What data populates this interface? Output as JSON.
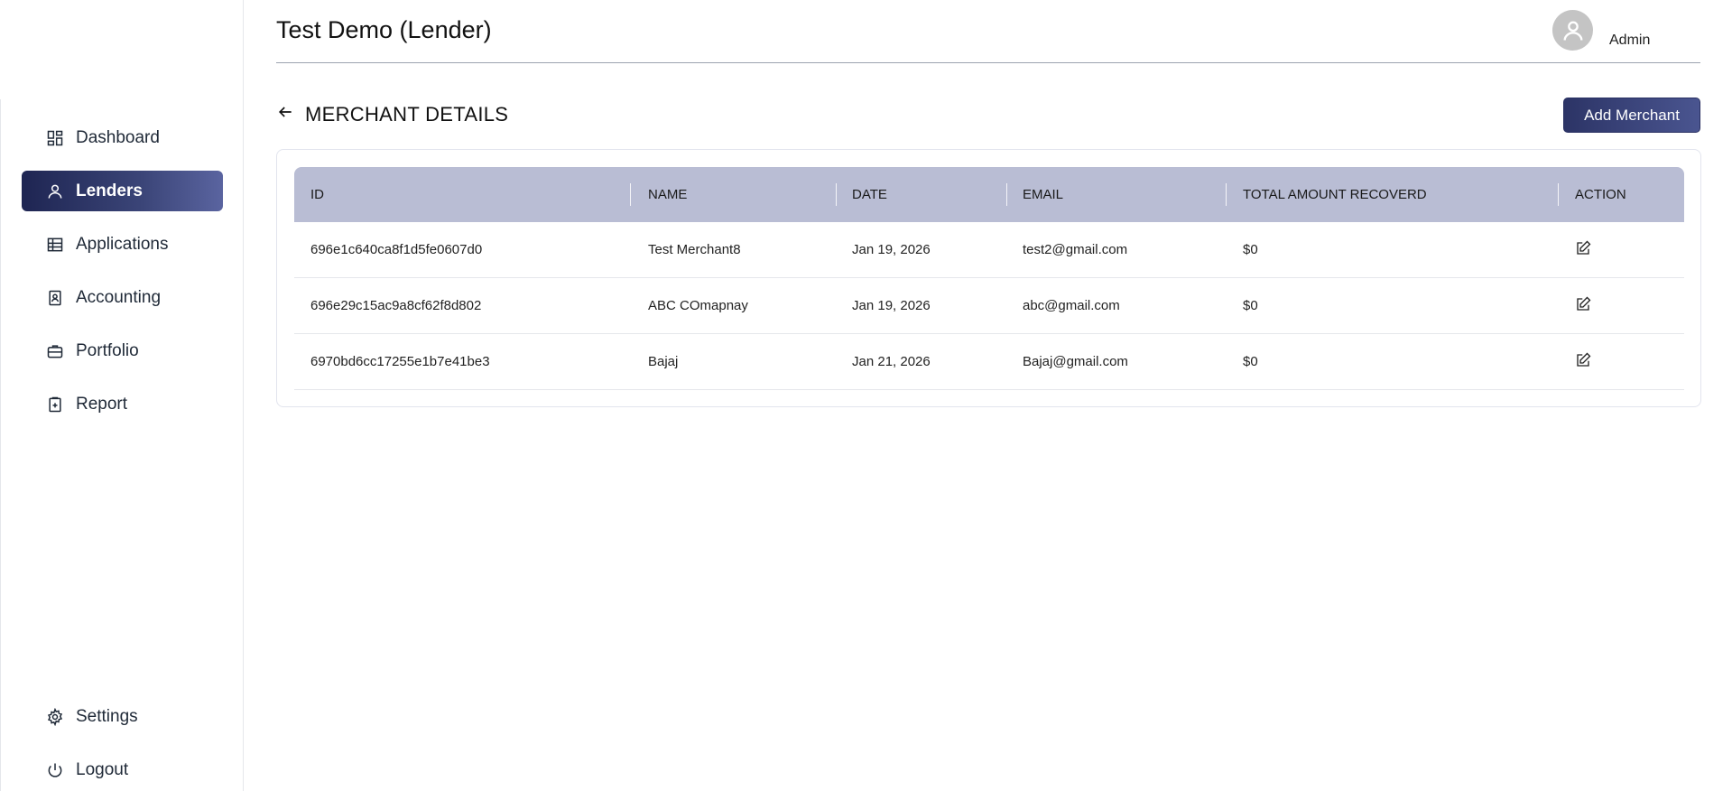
{
  "header": {
    "title": "Test Demo (Lender)",
    "user": "Admin"
  },
  "sidebar": {
    "items": [
      {
        "label": "Dashboard"
      },
      {
        "label": "Lenders"
      },
      {
        "label": "Applications"
      },
      {
        "label": "Accounting"
      },
      {
        "label": "Portfolio"
      },
      {
        "label": "Report"
      }
    ],
    "bottom": [
      {
        "label": "Settings"
      },
      {
        "label": "Logout"
      }
    ]
  },
  "page": {
    "title": "MERCHANT DETAILS",
    "add_button": "Add Merchant"
  },
  "table": {
    "columns": [
      "ID",
      "NAME",
      "DATE",
      "EMAIL",
      "TOTAL AMOUNT RECOVERD",
      "ACTION"
    ],
    "rows": [
      {
        "id": "696e1c640ca8f1d5fe0607d0",
        "name": "Test Merchant8",
        "date": "Jan 19, 2026",
        "email": "test2@gmail.com",
        "amount": "$0"
      },
      {
        "id": "696e29c15ac9a8cf62f8d802",
        "name": "ABC COmapnay",
        "date": "Jan 19, 2026",
        "email": "abc@gmail.com",
        "amount": "$0"
      },
      {
        "id": "6970bd6cc17255e1b7e41be3",
        "name": "Bajaj",
        "date": "Jan 21, 2026",
        "email": "Bajaj@gmail.com",
        "amount": "$0"
      }
    ]
  },
  "colors": {
    "accent": "#2c3466",
    "table_header": "#b9bdd4"
  }
}
